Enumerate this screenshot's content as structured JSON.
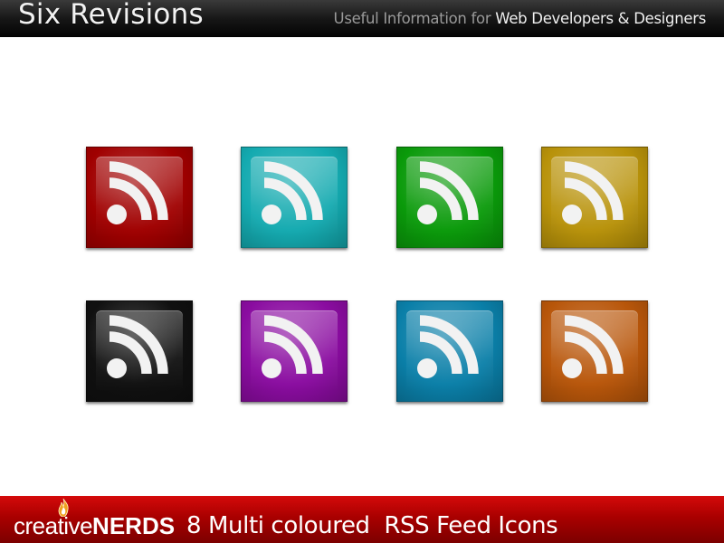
{
  "header": {
    "site_title": "Six Revisions",
    "tagline_prefix": "Useful Information for",
    "tagline_highlight": "Web Developers & Designers"
  },
  "icons": [
    {
      "label": "RSS",
      "color": "#a00000",
      "icon": "rss-icon"
    },
    {
      "label": "RSS",
      "color": "#14aab0",
      "icon": "rss-icon"
    },
    {
      "label": "RSS",
      "color": "#0a9a0a",
      "icon": "rss-icon"
    },
    {
      "label": "RSS",
      "color": "#b8920a",
      "icon": "rss-icon"
    },
    {
      "label": "RSS",
      "color": "#101010",
      "icon": "rss-icon"
    },
    {
      "label": "RSS",
      "color": "#8a0ca0",
      "icon": "rss-icon"
    },
    {
      "label": "RSS",
      "color": "#0a7fa8",
      "icon": "rss-icon"
    },
    {
      "label": "RSS",
      "color": "#b8560a",
      "icon": "rss-icon"
    }
  ],
  "footer": {
    "brand_prefix": "creative",
    "brand_highlight": "NERDS",
    "caption": "8 Multi coloured  RSS Feed Icons"
  }
}
